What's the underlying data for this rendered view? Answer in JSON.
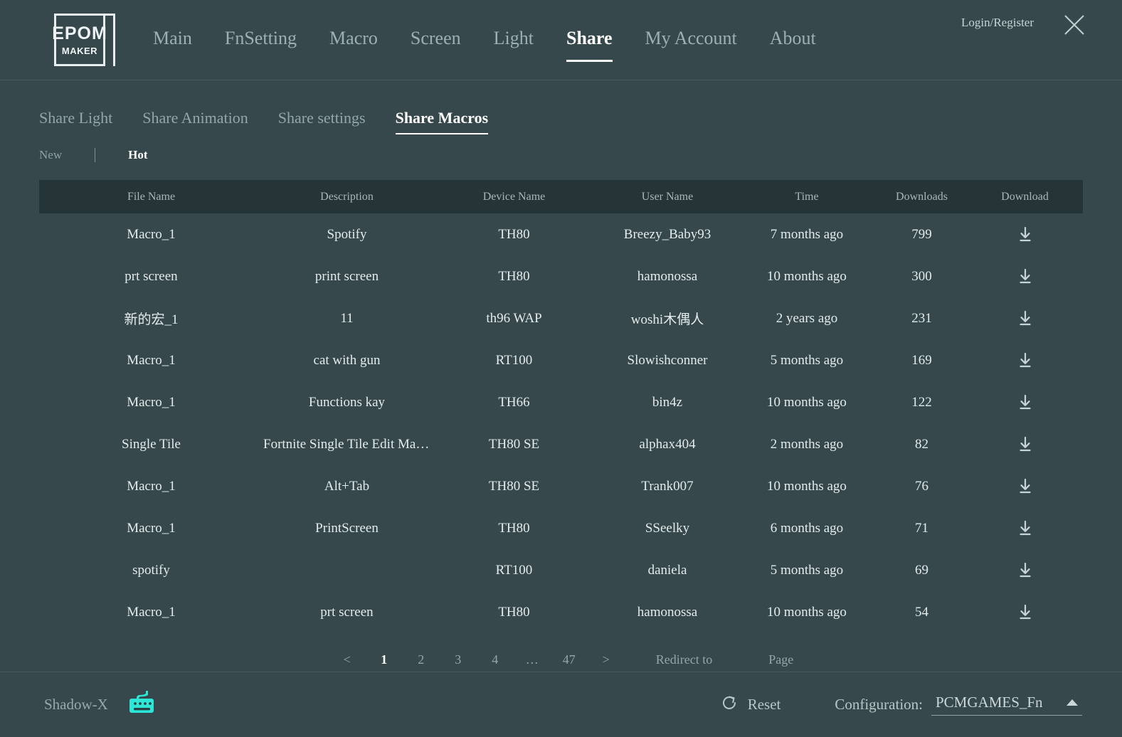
{
  "header": {
    "logo": {
      "line1": "EPOM",
      "line2": "MAKER"
    },
    "nav": [
      {
        "label": "Main",
        "active": false
      },
      {
        "label": "FnSetting",
        "active": false
      },
      {
        "label": "Macro",
        "active": false
      },
      {
        "label": "Screen",
        "active": false
      },
      {
        "label": "Light",
        "active": false
      },
      {
        "label": "Share",
        "active": true
      },
      {
        "label": "My Account",
        "active": false
      },
      {
        "label": "About",
        "active": false
      }
    ],
    "login_label": "Login/Register",
    "close_icon": "close-icon"
  },
  "subtabs": [
    {
      "label": "Share Light",
      "active": false
    },
    {
      "label": "Share Animation",
      "active": false
    },
    {
      "label": "Share settings",
      "active": false
    },
    {
      "label": "Share Macros",
      "active": true
    }
  ],
  "sort": {
    "new_label": "New",
    "hot_label": "Hot",
    "active": "Hot"
  },
  "table": {
    "columns": [
      "File Name",
      "Description",
      "Device Name",
      "User Name",
      "Time",
      "Downloads",
      "Download"
    ],
    "download_icon": "download-icon",
    "rows": [
      {
        "file": "Macro_1",
        "desc": "Spotify",
        "device": "TH80",
        "user": "Breezy_Baby93",
        "time": "7 months ago",
        "downloads": "799"
      },
      {
        "file": "prt screen",
        "desc": "print screen",
        "device": "TH80",
        "user": "hamonossa",
        "time": "10 months ago",
        "downloads": "300"
      },
      {
        "file": "新的宏_1",
        "desc": "11",
        "device": "th96 WAP",
        "user": "woshi木偶人",
        "time": "2 years ago",
        "downloads": "231"
      },
      {
        "file": "Macro_1",
        "desc": "cat with gun",
        "device": "RT100",
        "user": "Slowishconner",
        "time": "5 months ago",
        "downloads": "169"
      },
      {
        "file": "Macro_1",
        "desc": "Functions kay",
        "device": "TH66",
        "user": "bin4z",
        "time": "10 months ago",
        "downloads": "122"
      },
      {
        "file": "Single Tile",
        "desc": "Fortnite Single Tile Edit Macro (B…",
        "device": "TH80 SE",
        "user": "alphax404",
        "time": "2 months ago",
        "downloads": "82"
      },
      {
        "file": "Macro_1",
        "desc": "Alt+Tab",
        "device": "TH80 SE",
        "user": "Trank007",
        "time": "10 months ago",
        "downloads": "76"
      },
      {
        "file": "Macro_1",
        "desc": "PrintScreen",
        "device": "TH80",
        "user": "SSeelky",
        "time": "6 months ago",
        "downloads": "71"
      },
      {
        "file": "spotify",
        "desc": "",
        "device": "RT100",
        "user": "daniela",
        "time": "5 months ago",
        "downloads": "69"
      },
      {
        "file": "Macro_1",
        "desc": "prt screen",
        "device": "TH80",
        "user": "hamonossa",
        "time": "10 months ago",
        "downloads": "54"
      }
    ]
  },
  "pagination": {
    "prev": "<",
    "next": ">",
    "pages": [
      "1",
      "2",
      "3",
      "4",
      "…",
      "47"
    ],
    "current": "1",
    "redirect_label": "Redirect to",
    "page_label": "Page",
    "redirect_value": "",
    "redirect_placeholder": ""
  },
  "statusbar": {
    "device_name": "Shadow-X",
    "keyboard_icon": "keyboard-icon",
    "reset_label": "Reset",
    "reset_icon": "refresh-icon",
    "configuration_label": "Configuration:",
    "configuration_value": "PCMGAMES_Fn",
    "caret_icon": "chevron-up-icon"
  },
  "colors": {
    "background": "#36484b",
    "table_header": "#253437",
    "accent_cyan": "#2ee6d6",
    "text_primary": "#e4ebec",
    "text_muted": "#93a6a8"
  }
}
